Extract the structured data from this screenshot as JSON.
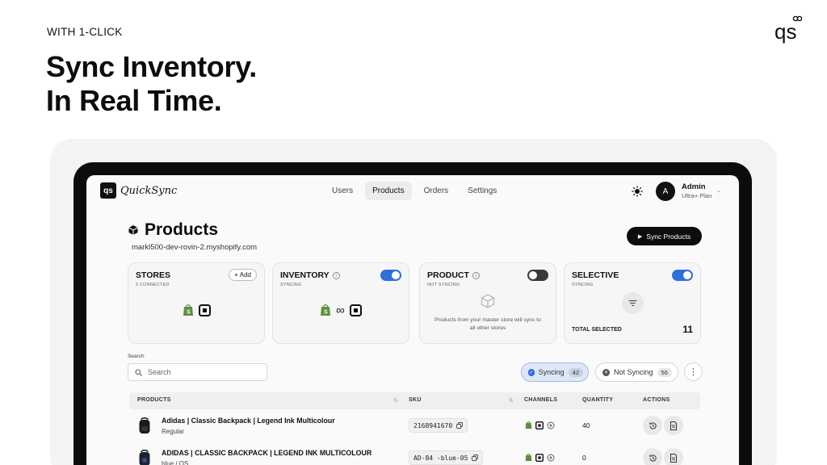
{
  "hero": {
    "eyebrow": "WITH 1-CLICK",
    "headline_line1": "Sync Inventory.",
    "headline_line2": "In Real Time."
  },
  "brand": {
    "corner_logo": "qs"
  },
  "app": {
    "logo_mark": "qs",
    "logo_word": "QuickSync",
    "nav": [
      "Users",
      "Products",
      "Orders",
      "Settings"
    ],
    "active_tab": "Products",
    "theme_icon": "sun-icon",
    "user": {
      "initial": "A",
      "name": "Admin",
      "plan": "Ultra+ Plan"
    }
  },
  "page": {
    "title": "Products",
    "store_url": "markl500-dev-rovin-2.myshopify.com",
    "sync_button": "Sync Products"
  },
  "cards": {
    "stores": {
      "title": "STORES",
      "sub": "2 CONNECTED",
      "add_label": "Add",
      "channels": [
        "shopify",
        "square"
      ]
    },
    "inventory": {
      "title": "INVENTORY",
      "sub": "SYNCING",
      "toggle": "on"
    },
    "product": {
      "title": "PRODUCT",
      "sub": "NOT SYNCING",
      "toggle": "off",
      "note": "Products from your master store will sync to all other stores"
    },
    "selective": {
      "title": "SELECTIVE",
      "sub": "SYNCING",
      "toggle": "on",
      "total_label": "TOTAL SELECTED",
      "total_value": "11"
    }
  },
  "search": {
    "label": "Search",
    "placeholder": "Search",
    "value": ""
  },
  "filters": {
    "syncing": {
      "label": "Syncing",
      "count": "42"
    },
    "not_syncing": {
      "label": "Not Syncing",
      "count": "56"
    }
  },
  "table": {
    "headers": {
      "products": "PRODUCTS",
      "sku": "SKU",
      "channels": "CHANNELS",
      "quantity": "QUANTITY",
      "actions": "ACTIONS"
    },
    "rows": [
      {
        "name": "Adidas | Classic Backpack | Legend Ink Multicolour",
        "variant": "Regular",
        "sku": "2168941670",
        "quantity": "40"
      },
      {
        "name": "ADIDAS | CLASSIC BACKPACK | LEGEND INK MULTICOLOUR",
        "variant": "blue / OS",
        "sku": "AD-84 -blue-05",
        "quantity": "0"
      }
    ]
  },
  "colors": {
    "accent": "#2f6fdc",
    "dark": "#0d0d0d",
    "shopify": "#5e8e3e"
  }
}
